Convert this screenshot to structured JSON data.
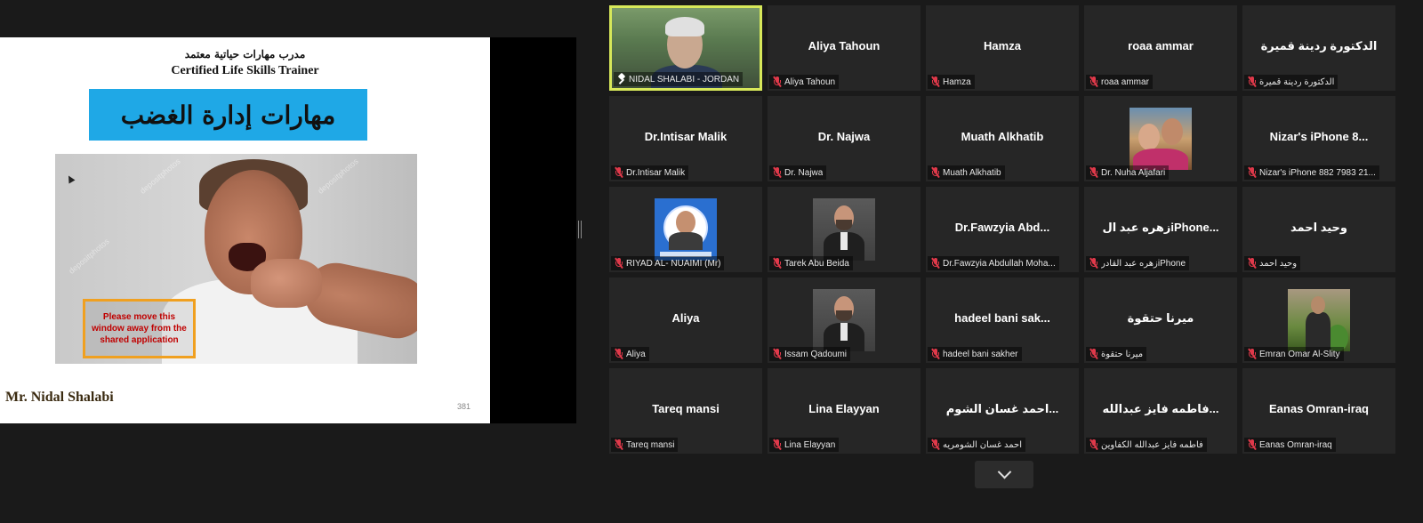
{
  "slide": {
    "arabic_top": "مدرب مهارات حياتية معتمد",
    "english_top": "Certified Life Skills Trainer",
    "banner": "مهارات إدارة الغضب",
    "warning": "Please move this window away from the shared application",
    "presenter": "Mr. Nidal Shalabi",
    "slide_number": "381"
  },
  "participants": [
    {
      "title": "",
      "name": "NIDAL SHALABI - JORDAN",
      "type": "video",
      "active": true,
      "muted": false
    },
    {
      "title": "Aliya Tahoun",
      "name": "Aliya Tahoun",
      "type": "name"
    },
    {
      "title": "Hamza",
      "name": "Hamza",
      "type": "name"
    },
    {
      "title": "roaa ammar",
      "name": "roaa ammar",
      "type": "name"
    },
    {
      "title": "الدكتورة ردينة قميرة",
      "name": "الدكتورة ردينة قميرة",
      "type": "name"
    },
    {
      "title": "Dr.Intisar Malik",
      "name": "Dr.Intisar Malik",
      "type": "name"
    },
    {
      "title": "Dr. Najwa",
      "name": "Dr. Najwa",
      "type": "name"
    },
    {
      "title": "Muath Alkhatib",
      "name": "Muath Alkhatib",
      "type": "name"
    },
    {
      "title": "",
      "name": "Dr. Nuha Aljafari",
      "type": "avatar",
      "avatar": "couple-photo"
    },
    {
      "title": "Nizar's iPhone 8...",
      "name": "Nizar's iPhone 882 7983 21...",
      "type": "name"
    },
    {
      "title": "",
      "name": "RIYAD AL- NUAIMI (Mr)",
      "type": "avatar",
      "avatar": "riyad-photo"
    },
    {
      "title": "",
      "name": "Tarek Abu Beida",
      "type": "avatar",
      "avatar": "man-photo"
    },
    {
      "title": "Dr.Fawzyia  Abd...",
      "name": "Dr.Fawzyia Abdullah Moha...",
      "type": "name"
    },
    {
      "title": "زهره عبد الiPhone...",
      "name": "زهره عبد القادرiPhone",
      "type": "name"
    },
    {
      "title": "وحيد احمد",
      "name": "وحيد احمد",
      "type": "name"
    },
    {
      "title": "Aliya",
      "name": "Aliya",
      "type": "name"
    },
    {
      "title": "",
      "name": "Issam Qadoumi",
      "type": "avatar",
      "avatar": "man-photo"
    },
    {
      "title": "hadeel bani sak...",
      "name": "hadeel bani sakher",
      "type": "name"
    },
    {
      "title": "ميرنا حتقوة",
      "name": "ميرنا حتقوة",
      "type": "name"
    },
    {
      "title": "",
      "name": "Emran Omar Al-Slity",
      "type": "avatar",
      "avatar": "emran-photo"
    },
    {
      "title": "Tareq mansi",
      "name": "Tareq mansi",
      "type": "name"
    },
    {
      "title": "Lina Elayyan",
      "name": "Lina Elayyan",
      "type": "name"
    },
    {
      "title": "احمد غسان الشوم...",
      "name": "احمد غسان الشومريه",
      "type": "name"
    },
    {
      "title": "فاطمه فايز عبدالله...",
      "name": "فاطمه فايز عبدالله الكفاوين",
      "type": "name"
    },
    {
      "title": "Eanas Omran-iraq",
      "name": "Eanas Omran-iraq",
      "type": "name"
    }
  ]
}
